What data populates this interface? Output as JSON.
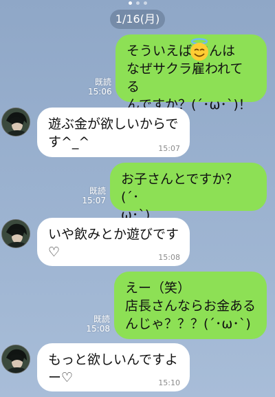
{
  "date_divider": "1/16(月)",
  "emoji_icon": "halo-smile-emoji",
  "messages": [
    {
      "side": "sent",
      "text": "そういえば   さんは\nなぜサクラ雇われてる\nんですか？(´･ω･`)！",
      "read": "既読",
      "time": "15:06"
    },
    {
      "side": "recv",
      "text": "遊ぶ金が欲しいからで\nす^_^",
      "time": "15:07"
    },
    {
      "side": "sent",
      "text": "お子さんとですか？(´･\nω･`)",
      "read": "既読",
      "time": "15:07"
    },
    {
      "side": "recv",
      "text": "いや飲みとか遊びです\n♡",
      "time": "15:08"
    },
    {
      "side": "sent",
      "text": "えー（笑）\n店長さんならお金ある\nんじゃ？？？(´･ω･`)",
      "read": "既読",
      "time": "15:08"
    },
    {
      "side": "recv",
      "text": "もっと欲しいんですよ\nー♡",
      "time": "15:10"
    }
  ],
  "colors": {
    "sent_bubble": "#8de055",
    "received_bubble": "#ffffff",
    "background": "#9ab1cf"
  }
}
